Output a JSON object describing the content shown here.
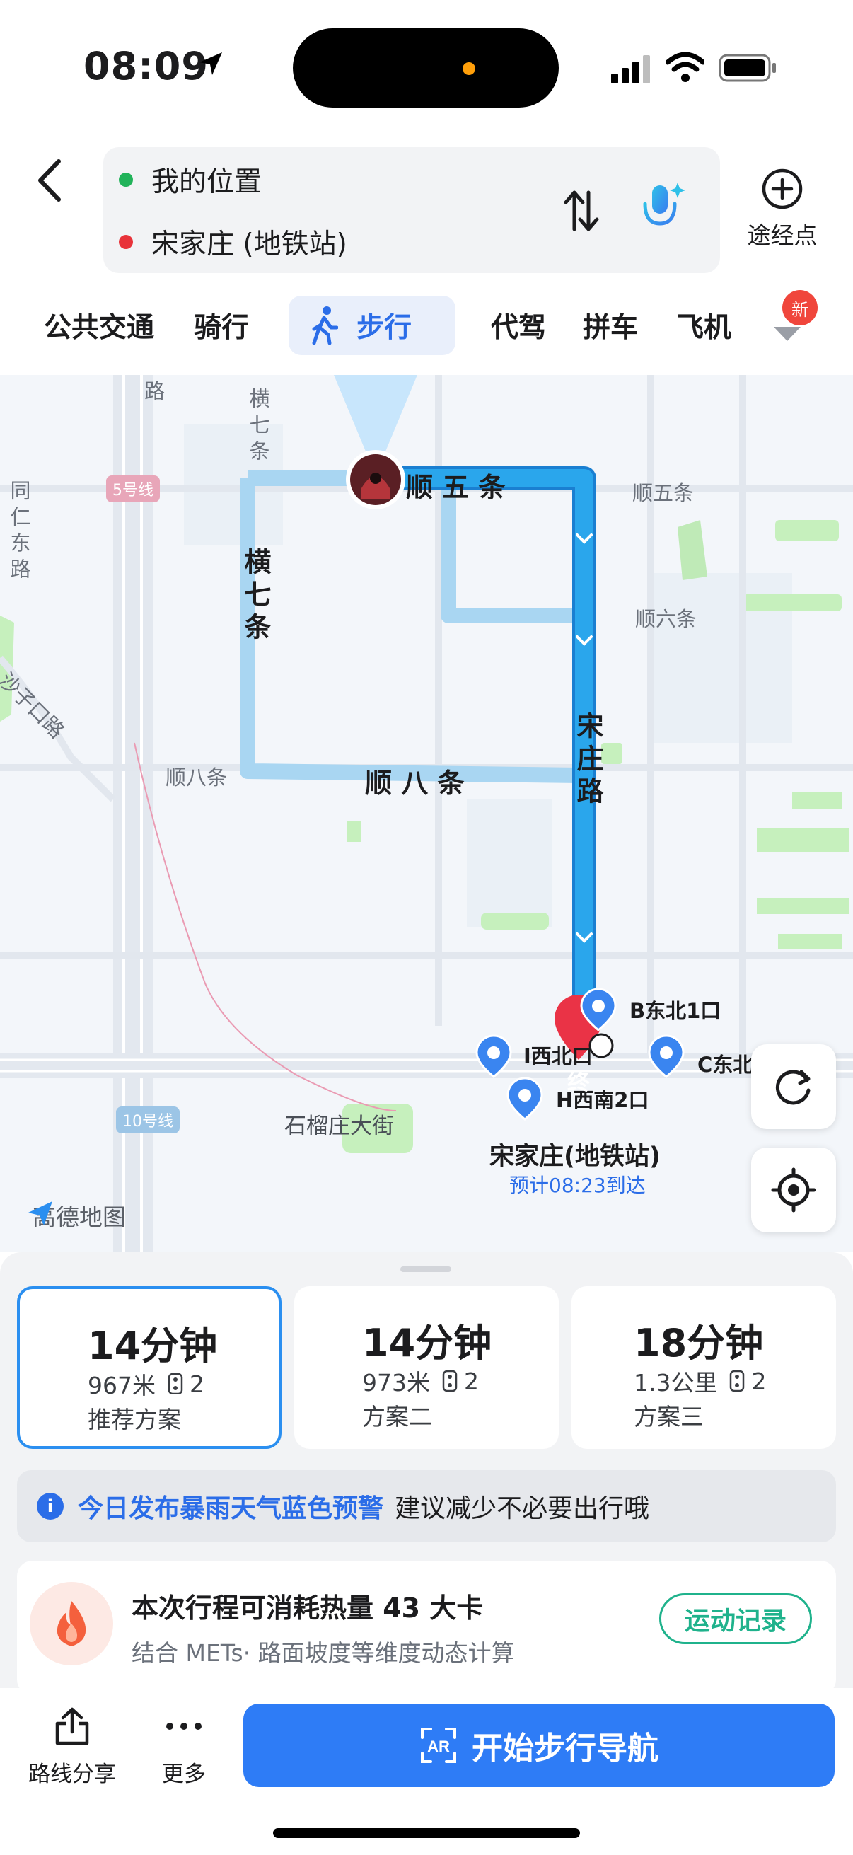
{
  "status_bar": {
    "time": "08:09"
  },
  "route": {
    "start": "我的位置",
    "end": "宋家庄 (地铁站)",
    "waypoint_label": "途经点",
    "start_color": "#22b35a",
    "end_color": "#e8333a"
  },
  "tabs": {
    "items": [
      "公共交通",
      "骑行",
      "步行",
      "代驾",
      "拼车",
      "飞机"
    ],
    "active": "步行",
    "new_badge": "新"
  },
  "map": {
    "roads": {
      "shun_wu_tiao": "顺 五 条",
      "shun_wu_tiao_right": "顺五条",
      "shun_liu_tiao": "顺六条",
      "shun_ba_tiao": "顺 八 条",
      "shun_ba_tiao_left": "顺八条",
      "heng_qi_tiao_top": "横七条",
      "heng_qi_tiao": "横七条",
      "songzhuang_lu": "宋庄路",
      "tongren_dong_lu": "同仁东路",
      "shazikou_lu": "沙子口路",
      "lu": "路",
      "shiliuzhuang_dajie": "石榴庄大街"
    },
    "lines": {
      "line5": "5号线",
      "line10": "10号线"
    },
    "exits": {
      "b": "B东北1口",
      "i": "I西北口",
      "c": "C东北",
      "h": "H西南2口"
    },
    "end_marker": "终",
    "station": "宋家庄(地铁站)",
    "eta": "预计08:23到达",
    "logo": "高德地图",
    "route_color": "#2aa6ec",
    "alt_route_color": "#a9d6f2"
  },
  "plans": [
    {
      "duration": "14分钟",
      "distance": "967米",
      "lights": "2",
      "name": "推荐方案"
    },
    {
      "duration": "14分钟",
      "distance": "973米",
      "lights": "2",
      "name": "方案二"
    },
    {
      "duration": "18分钟",
      "distance": "1.3公里",
      "lights": "2",
      "name": "方案三"
    }
  ],
  "alert": {
    "warning": "今日发布暴雨天气蓝色预警",
    "advice": "建议减少不必要出行哦"
  },
  "calorie": {
    "title": "本次行程可消耗热量 43 大卡",
    "subtitle": "结合 METs· 路面坡度等维度动态计算",
    "record_button": "运动记录"
  },
  "bottom": {
    "share": "路线分享",
    "more": "更多",
    "start_nav": "开始步行导航"
  },
  "icons": {
    "back": "chevron-left-icon",
    "swap": "swap-icon",
    "mic": "mic-icon",
    "add": "plus-circle-icon",
    "walk": "walk-icon",
    "refresh": "refresh-icon",
    "locate": "locate-icon",
    "share": "share-icon",
    "more": "more-icon",
    "ar": "ar-icon",
    "flame": "flame-icon",
    "info": "info-icon"
  }
}
